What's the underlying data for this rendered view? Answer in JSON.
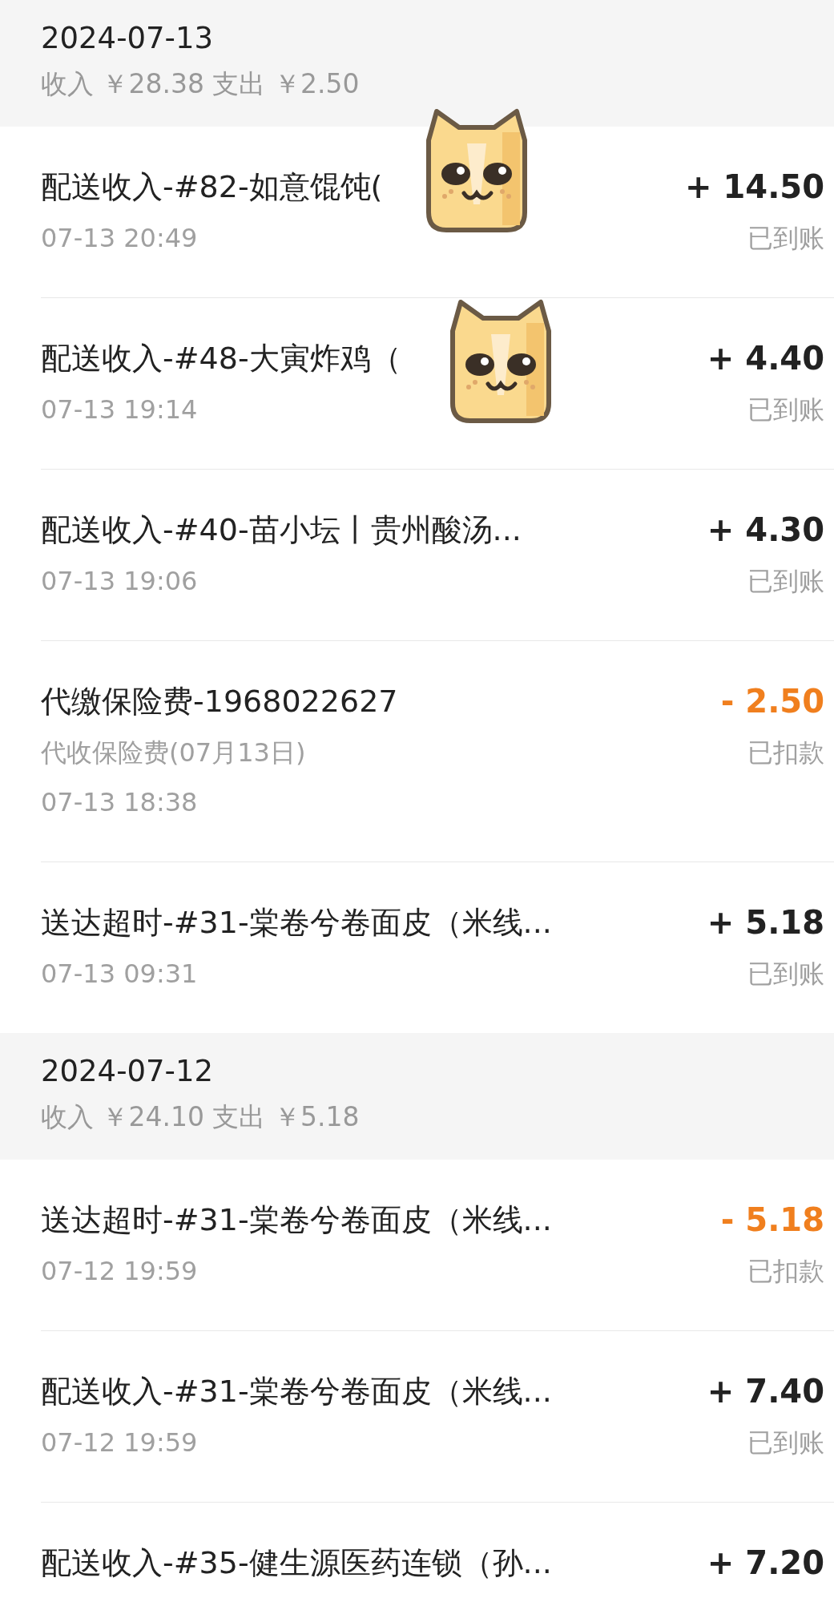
{
  "groups": [
    {
      "date": "2024-07-13",
      "summary": "收入 ￥28.38 支出 ￥2.50",
      "items": [
        {
          "title": "配送收入-#82-如意馄饨(",
          "time": "07-13 20:49",
          "amount": "+ 14.50",
          "kind": "income",
          "status": "已到账",
          "sticker": true
        },
        {
          "title": "配送收入-#48-大寅炸鸡（",
          "time": "07-13 19:14",
          "amount": "+ 4.40",
          "kind": "income",
          "status": "已到账",
          "sticker": true
        },
        {
          "title": "配送收入-#40-苗小坛丨贵州酸汤...",
          "time": "07-13 19:06",
          "amount": "+ 4.30",
          "kind": "income",
          "status": "已到账"
        },
        {
          "title": "代缴保险费-1968022627",
          "note": "代收保险费(07月13日)",
          "time": "07-13 18:38",
          "amount": "- 2.50",
          "kind": "expense",
          "status": "已扣款"
        },
        {
          "title": "送达超时-#31-棠卷兮卷面皮（米线...",
          "time": "07-13 09:31",
          "amount": "+ 5.18",
          "kind": "income",
          "status": "已到账"
        }
      ]
    },
    {
      "date": "2024-07-12",
      "summary": "收入 ￥24.10 支出 ￥5.18",
      "items": [
        {
          "title": "送达超时-#31-棠卷兮卷面皮（米线...",
          "time": "07-12 19:59",
          "amount": "- 5.18",
          "kind": "expense",
          "status": "已扣款"
        },
        {
          "title": "配送收入-#31-棠卷兮卷面皮（米线...",
          "time": "07-12 19:59",
          "amount": "+ 7.40",
          "kind": "income",
          "status": "已到账"
        },
        {
          "title": "配送收入-#35-健生源医药连锁（孙...",
          "amount": "+ 7.20",
          "kind": "income"
        }
      ]
    }
  ]
}
